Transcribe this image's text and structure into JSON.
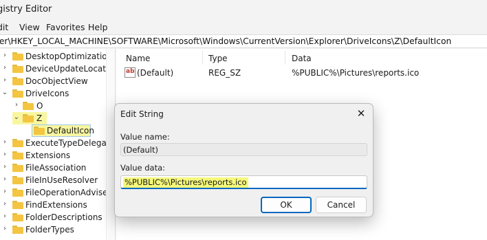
{
  "window": {
    "title": "gistry Editor"
  },
  "menu": [
    "dit",
    "View",
    "Favorites",
    "Help"
  ],
  "address": "ter\\HKEY_LOCAL_MACHINE\\SOFTWARE\\Microsoft\\Windows\\CurrentVersion\\Explorer\\DriveIcons\\Z\\DefaultIcon",
  "tree": {
    "items": [
      {
        "label": "DesktopOptimization",
        "expandable": true
      },
      {
        "label": "DeviceUpdateLocation",
        "expandable": true
      },
      {
        "label": "DocObjectView",
        "expandable": true
      },
      {
        "label": "DriveIcons",
        "expanded": true
      },
      {
        "label": "O",
        "expandable": true
      },
      {
        "label": "Z",
        "expanded": true,
        "highlighted": true
      },
      {
        "label": "DefaultIcon",
        "selected": true,
        "highlighted": true
      },
      {
        "label": "ExecuteTypeDelegates",
        "expandable": true
      },
      {
        "label": "Extensions",
        "expandable": true
      },
      {
        "label": "FileAssociation",
        "expandable": true
      },
      {
        "label": "FileInUseResolver",
        "expandable": true
      },
      {
        "label": "FileOperationAdviseSi",
        "expandable": true
      },
      {
        "label": "FindExtensions",
        "expandable": true
      },
      {
        "label": "FolderDescriptions",
        "expandable": true
      },
      {
        "label": "FolderTypes",
        "expandable": true
      }
    ]
  },
  "list": {
    "headers": {
      "name": "Name",
      "type": "Type",
      "data": "Data"
    },
    "rows": [
      {
        "name": "(Default)",
        "type": "REG_SZ",
        "data": "%PUBLIC%\\Pictures\\reports.ico",
        "icon": "reg-string-icon"
      }
    ]
  },
  "dialog": {
    "title": "Edit String",
    "close_glyph": "✕",
    "value_name_label": "Value name:",
    "value_name": "(Default)",
    "value_data_label": "Value data:",
    "value_data": "%PUBLIC%\\Pictures\\reports.ico",
    "ok_label": "OK",
    "cancel_label": "Cancel"
  },
  "colors": {
    "accent": "#0067c0",
    "highlight": "#f5f87a",
    "folder": "#f4c542"
  }
}
